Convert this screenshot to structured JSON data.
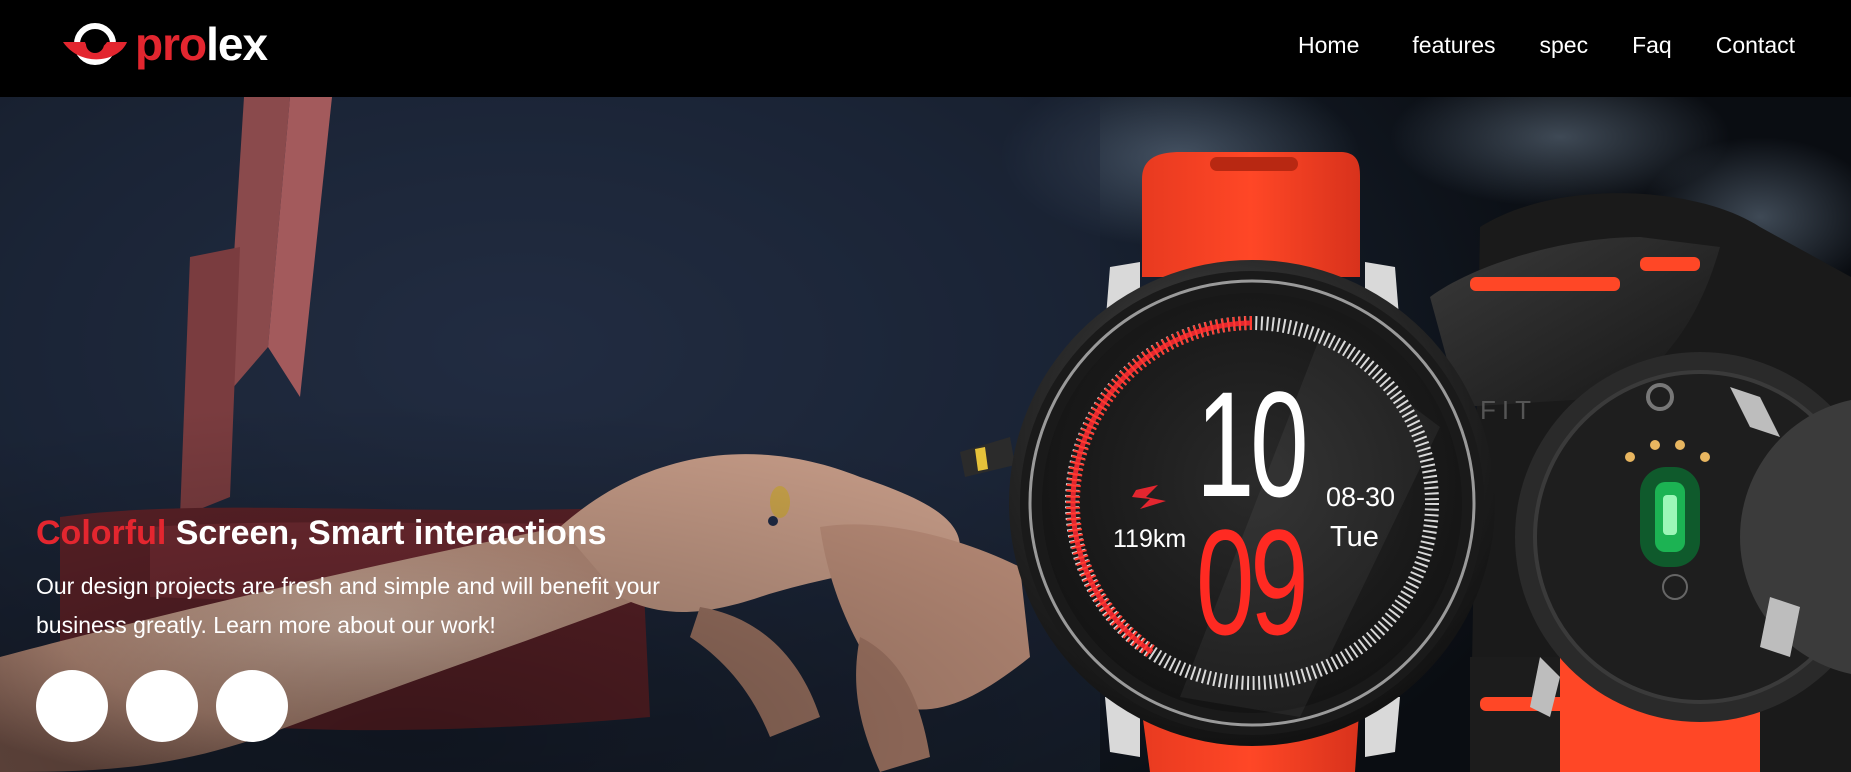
{
  "brand": {
    "logo_text_red": "pro",
    "logo_text_white": "lex",
    "logo_icon": "logo-mark-icon",
    "accent_color": "#e3262f"
  },
  "nav": {
    "items": [
      {
        "label": "Home"
      },
      {
        "label": "features"
      },
      {
        "label": "spec"
      },
      {
        "label": "Faq"
      },
      {
        "label": "Contact"
      }
    ]
  },
  "hero": {
    "headline_accent": "Colorful",
    "headline_rest": " Screen, Smart interactions",
    "subtext_line1": "Our design projects are fresh and simple and will benefit your",
    "subtext_line2": "business greatly. Learn more about our work!",
    "slider_dots": 3,
    "watch_display": {
      "hour": "10",
      "minute": "09",
      "date": "08-30",
      "weekday": "Tue",
      "distance": "119km"
    },
    "back_watch_text": "FIT"
  }
}
